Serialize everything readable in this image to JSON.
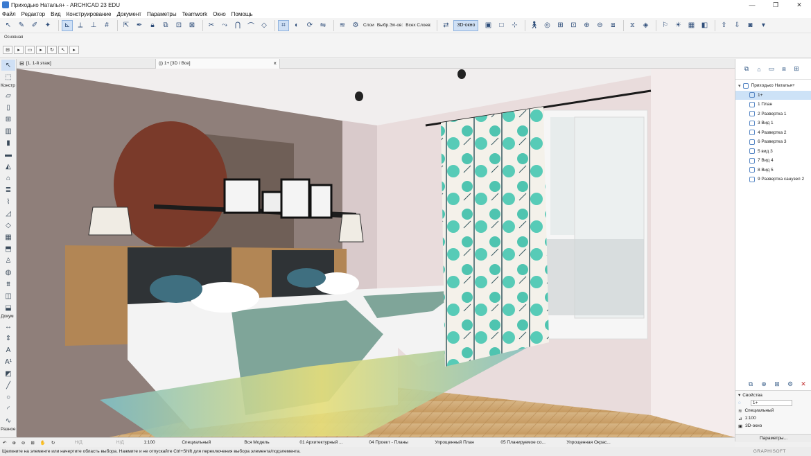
{
  "window": {
    "title": "Приходько Наталья+ - ARCHICAD 23 EDU",
    "controls": [
      "—",
      "❐",
      "✕"
    ]
  },
  "menu": [
    "Файл",
    "Редактор",
    "Вид",
    "Конструирование",
    "Документ",
    "Параметры",
    "Teamwork",
    "Окно",
    "Помощь"
  ],
  "toolbar": {
    "layers_label": "Слои",
    "select_label": "Выбр.Эл-ов:",
    "all_layers_label": "Всех Слоев:",
    "view_3d_label": "3D-окно"
  },
  "toolbar2": {
    "basic_label": "Основная"
  },
  "toolbox": {
    "construct_label": "Констр",
    "document_label": "Докум",
    "misc_label": "Разное"
  },
  "tabs": {
    "plan": "[1. 1-й этаж]",
    "view3d": "(|) 1+ [3D / Все]"
  },
  "navigator": {
    "root": "Приходько Наталья+",
    "items": [
      {
        "label": "1+",
        "selected": true
      },
      {
        "label": "1 План",
        "selected": false
      },
      {
        "label": "2 Развертка 1",
        "selected": false
      },
      {
        "label": "3 Вид 1",
        "selected": false
      },
      {
        "label": "4 Развертка 2",
        "selected": false
      },
      {
        "label": "6 Развертка 3",
        "selected": false
      },
      {
        "label": "5 вид 3",
        "selected": false
      },
      {
        "label": "7 Вид 4",
        "selected": false
      },
      {
        "label": "8 Вид 5",
        "selected": false
      },
      {
        "label": "9 Развертка санузел 2",
        "selected": false
      }
    ]
  },
  "properties": {
    "title": "Свойства",
    "name_value": "1+",
    "type": "Специальный",
    "scale": "1:100",
    "window": "3D-окно",
    "params_button": "Параметры..."
  },
  "quick_options": {
    "nd1": "Н/Д",
    "nd2": "Н/Д",
    "scale": "1:100",
    "special": "Специальный",
    "model": "Вся Модель",
    "arch": "01 Архитектурный ...",
    "project": "04 Проект - Планы",
    "simplified_plan": "Упрощенный План",
    "planned": "05 Планируемое со...",
    "simplified_paint": "Упрощенная Окрас..."
  },
  "status": {
    "message": "Щелкните на элементе или начертите область выбора. Нажмите и не отпускайте Ctrl+Shift для переключения выбора элемента/подэлемента.",
    "brand": "GRAPHISOFT"
  },
  "colors": {
    "accent": "#3b7bd0",
    "selection": "#cde2f7",
    "curtain": "#49c2ae",
    "wall": "#8f7f7a",
    "circle": "#7a3a2a",
    "floor": "#cfa877"
  }
}
